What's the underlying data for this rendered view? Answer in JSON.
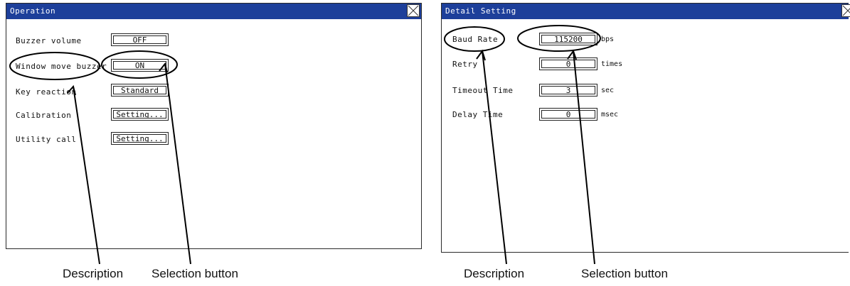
{
  "left_window": {
    "title": "Operation",
    "rows": [
      {
        "label": "Buzzer volume",
        "value": "OFF"
      },
      {
        "label": "Window move buzzer",
        "value": "ON"
      },
      {
        "label": "Key reaction",
        "value": "Standard"
      },
      {
        "label": "Calibration",
        "value": "Setting..."
      },
      {
        "label": "Utility call",
        "value": "Setting..."
      }
    ]
  },
  "right_window": {
    "title": "Detail Setting",
    "rows": [
      {
        "label": "Baud Rate",
        "value": "115200",
        "unit": "bps"
      },
      {
        "label": "Retry",
        "value": "0",
        "unit": "times"
      },
      {
        "label": "Timeout Time",
        "value": "3",
        "unit": "sec"
      },
      {
        "label": "Delay Time",
        "value": "0",
        "unit": "msec"
      }
    ]
  },
  "captions": {
    "left_description": "Description",
    "left_selection": "Selection button",
    "right_description": "Description",
    "right_selection": "Selection button"
  }
}
